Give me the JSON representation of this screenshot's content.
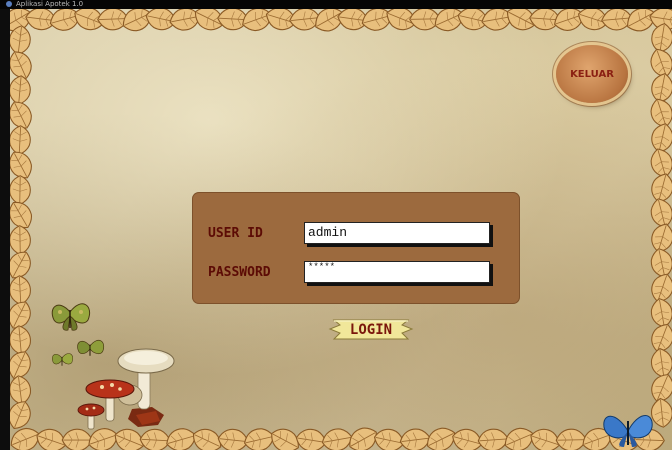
{
  "window": {
    "title": "Aplikasi Apotek 1.0",
    "icon": "app-icon"
  },
  "exit_button": {
    "label": "KELUAR",
    "icon": "wood-slice-icon"
  },
  "login_form": {
    "user_id_label": "USER ID",
    "user_id_value": "admin",
    "password_label": "PASSWORD",
    "password_value": "*****"
  },
  "login_button": {
    "label": "LOGIN",
    "icon": "paper-banner-icon"
  },
  "decorations": [
    "autumn-leaf-border",
    "butterfly-icon",
    "mushroom-icon",
    "blue-butterfly-icon"
  ],
  "colors": {
    "panel": "#9c6a3e",
    "label_text": "#5c0b05",
    "background": "#d4c59f",
    "exit_button": "#b87440"
  }
}
